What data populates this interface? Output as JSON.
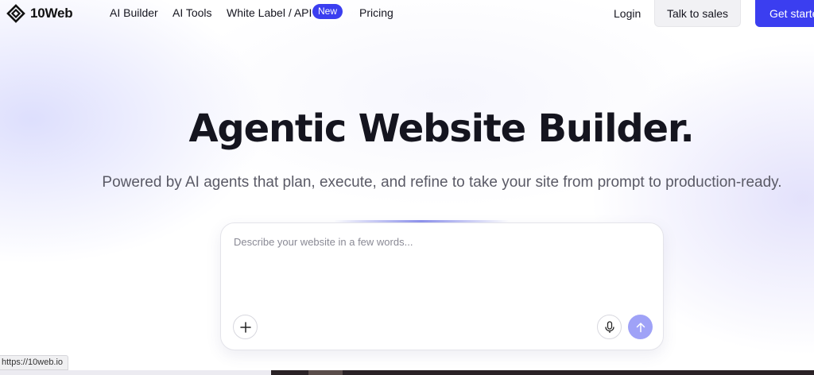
{
  "nav": {
    "logo_text": "10Web",
    "links": [
      "AI Builder",
      "AI Tools",
      "White Label / API",
      "Pricing"
    ],
    "new_badge": "New",
    "login": "Login",
    "talk_to_sales": "Talk to sales",
    "get_started": "Get started"
  },
  "hero": {
    "title": "Agentic Website Builder.",
    "subtitle": "Powered by AI agents that plan, execute, and refine to take your site from prompt to production-ready."
  },
  "prompt": {
    "placeholder": "Describe your website in a few words...",
    "icons": [
      "plus-icon",
      "microphone-icon",
      "arrow-up-icon"
    ]
  },
  "status_bar": {
    "url": "https://10web.io"
  },
  "colors": {
    "accent": "#3b3ef0",
    "send_button": "#9fa2f7",
    "text": "#15151f"
  }
}
